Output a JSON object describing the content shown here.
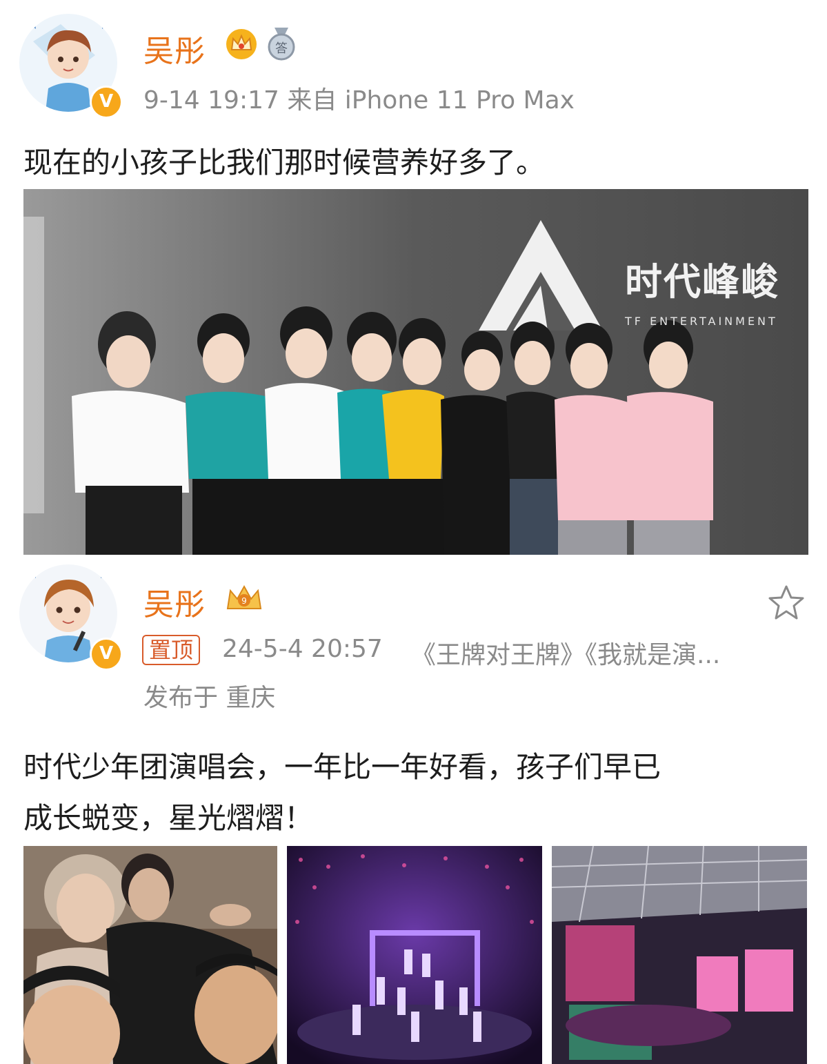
{
  "post1": {
    "user_name": "吴彤",
    "meta": "9-14 19:17  来自 iPhone 11 Pro Max",
    "verified_mark": "V",
    "text": "现在的小孩子比我们那时候营养好多了。",
    "photo": {
      "logo_title": "时代峰峻",
      "logo_subtitle": "TF ENTERTAINMENT"
    }
  },
  "post2": {
    "user_name": "吴彤",
    "verified_mark": "V",
    "pinned_label": "置顶",
    "timestamp": "24-5-4 20:57",
    "topics": "《王牌对王牌》《我就是演...",
    "location": "发布于 重庆",
    "text_line1": "时代少年团演唱会，一年比一年好看，孩子们早已",
    "text_line2": "成长蜕变，星光熠熠！"
  },
  "icons": {
    "crown": "crown-icon",
    "medal": "medal-icon",
    "star": "favorite-star-icon"
  },
  "colors": {
    "name": "#e8731b",
    "meta": "#8a8a8a",
    "pinned": "#d85b2a",
    "verified": "#f7a71a"
  }
}
